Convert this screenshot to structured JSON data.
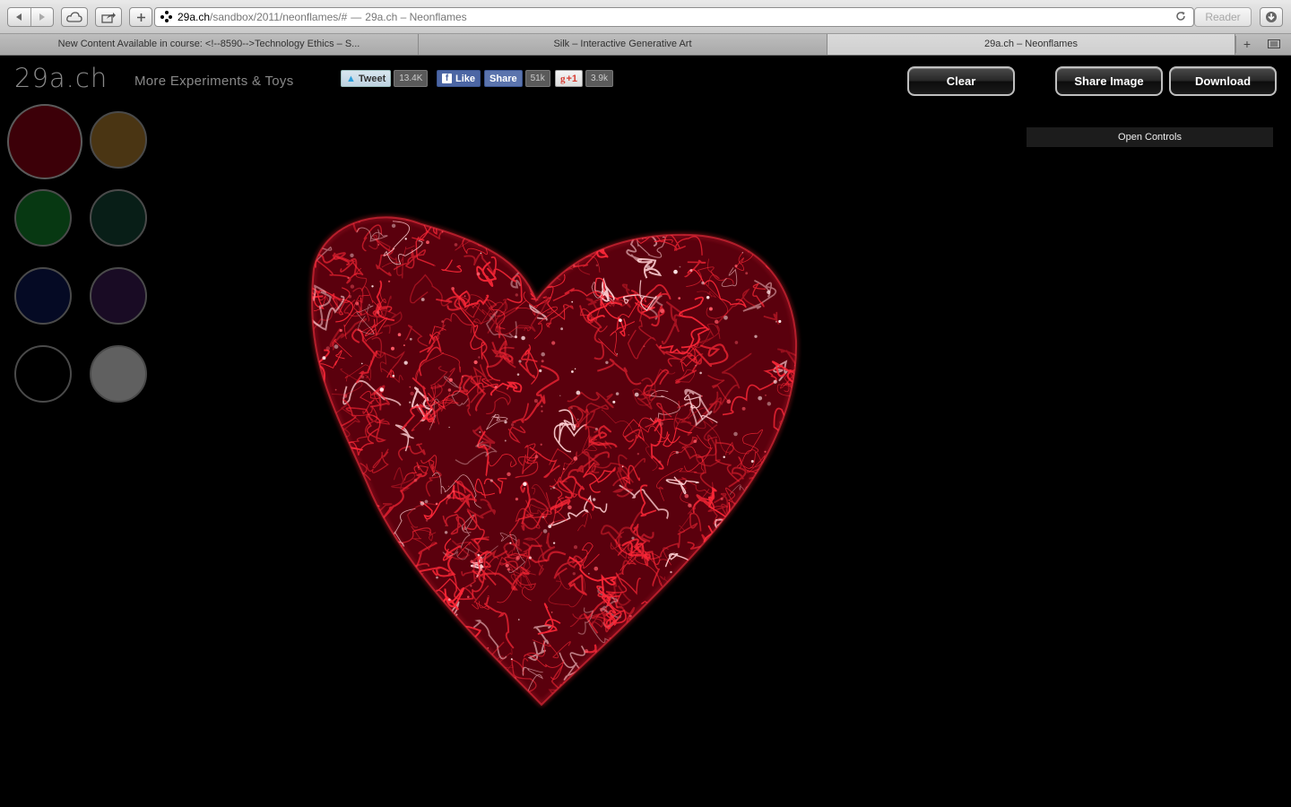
{
  "browser": {
    "url_host": "29a.ch",
    "url_path": "/sandbox/2011/neonflames/#",
    "url_separator": "—",
    "page_title": "29a.ch – Neonflames",
    "reader_label": "Reader",
    "tabs": [
      {
        "label": "New Content Available in course: <!--8590-->Technology Ethics – S...",
        "active": false
      },
      {
        "label": "Silk – Interactive Generative Art",
        "active": false
      },
      {
        "label": "29a.ch – Neonflames",
        "active": true
      }
    ],
    "icons": {
      "back": "back-arrow-icon",
      "forward": "forward-arrow-icon",
      "icloud": "cloud-icon",
      "share": "share-icon",
      "add": "plus-icon",
      "reload": "reload-icon",
      "downloads": "download-icon",
      "new_tab": "plus-icon",
      "tab_list": "list-icon"
    }
  },
  "header": {
    "logo": "29a.ch",
    "tagline": "More Experiments & Toys"
  },
  "social": {
    "tweet_label": "Tweet",
    "tweet_count": "13.4K",
    "like_label": "Like",
    "share_label": "Share",
    "fb_count": "51k",
    "gplus_label": "+1",
    "gplus_count": "3.9k"
  },
  "actions": {
    "clear_label": "Clear",
    "share_image_label": "Share Image",
    "download_label": "Download"
  },
  "controls": {
    "open_label": "Open Controls"
  },
  "palette": {
    "colors": [
      "#3c0008",
      "#4a3513",
      "#073812",
      "#081e17",
      "#050a24",
      "#190b24",
      "#000000",
      "#606060"
    ],
    "selected_index": 0
  },
  "canvas": {
    "shape": "heart",
    "flame_color": "#ff2838"
  }
}
